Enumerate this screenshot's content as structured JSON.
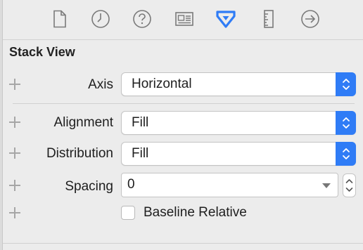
{
  "toolbar": {
    "icons": [
      "file-icon",
      "clock-icon",
      "help-icon",
      "identity-icon",
      "attributes-icon",
      "size-ruler-icon",
      "connections-arrow-icon"
    ],
    "accent": "#2f7cf6"
  },
  "section": {
    "title": "Stack View"
  },
  "rows": {
    "axis": {
      "label": "Axis",
      "value": "Horizontal"
    },
    "alignment": {
      "label": "Alignment",
      "value": "Fill"
    },
    "distribution": {
      "label": "Distribution",
      "value": "Fill"
    },
    "spacing": {
      "label": "Spacing",
      "value": "0"
    },
    "baseline": {
      "label": "Baseline Relative",
      "checked": false
    }
  }
}
